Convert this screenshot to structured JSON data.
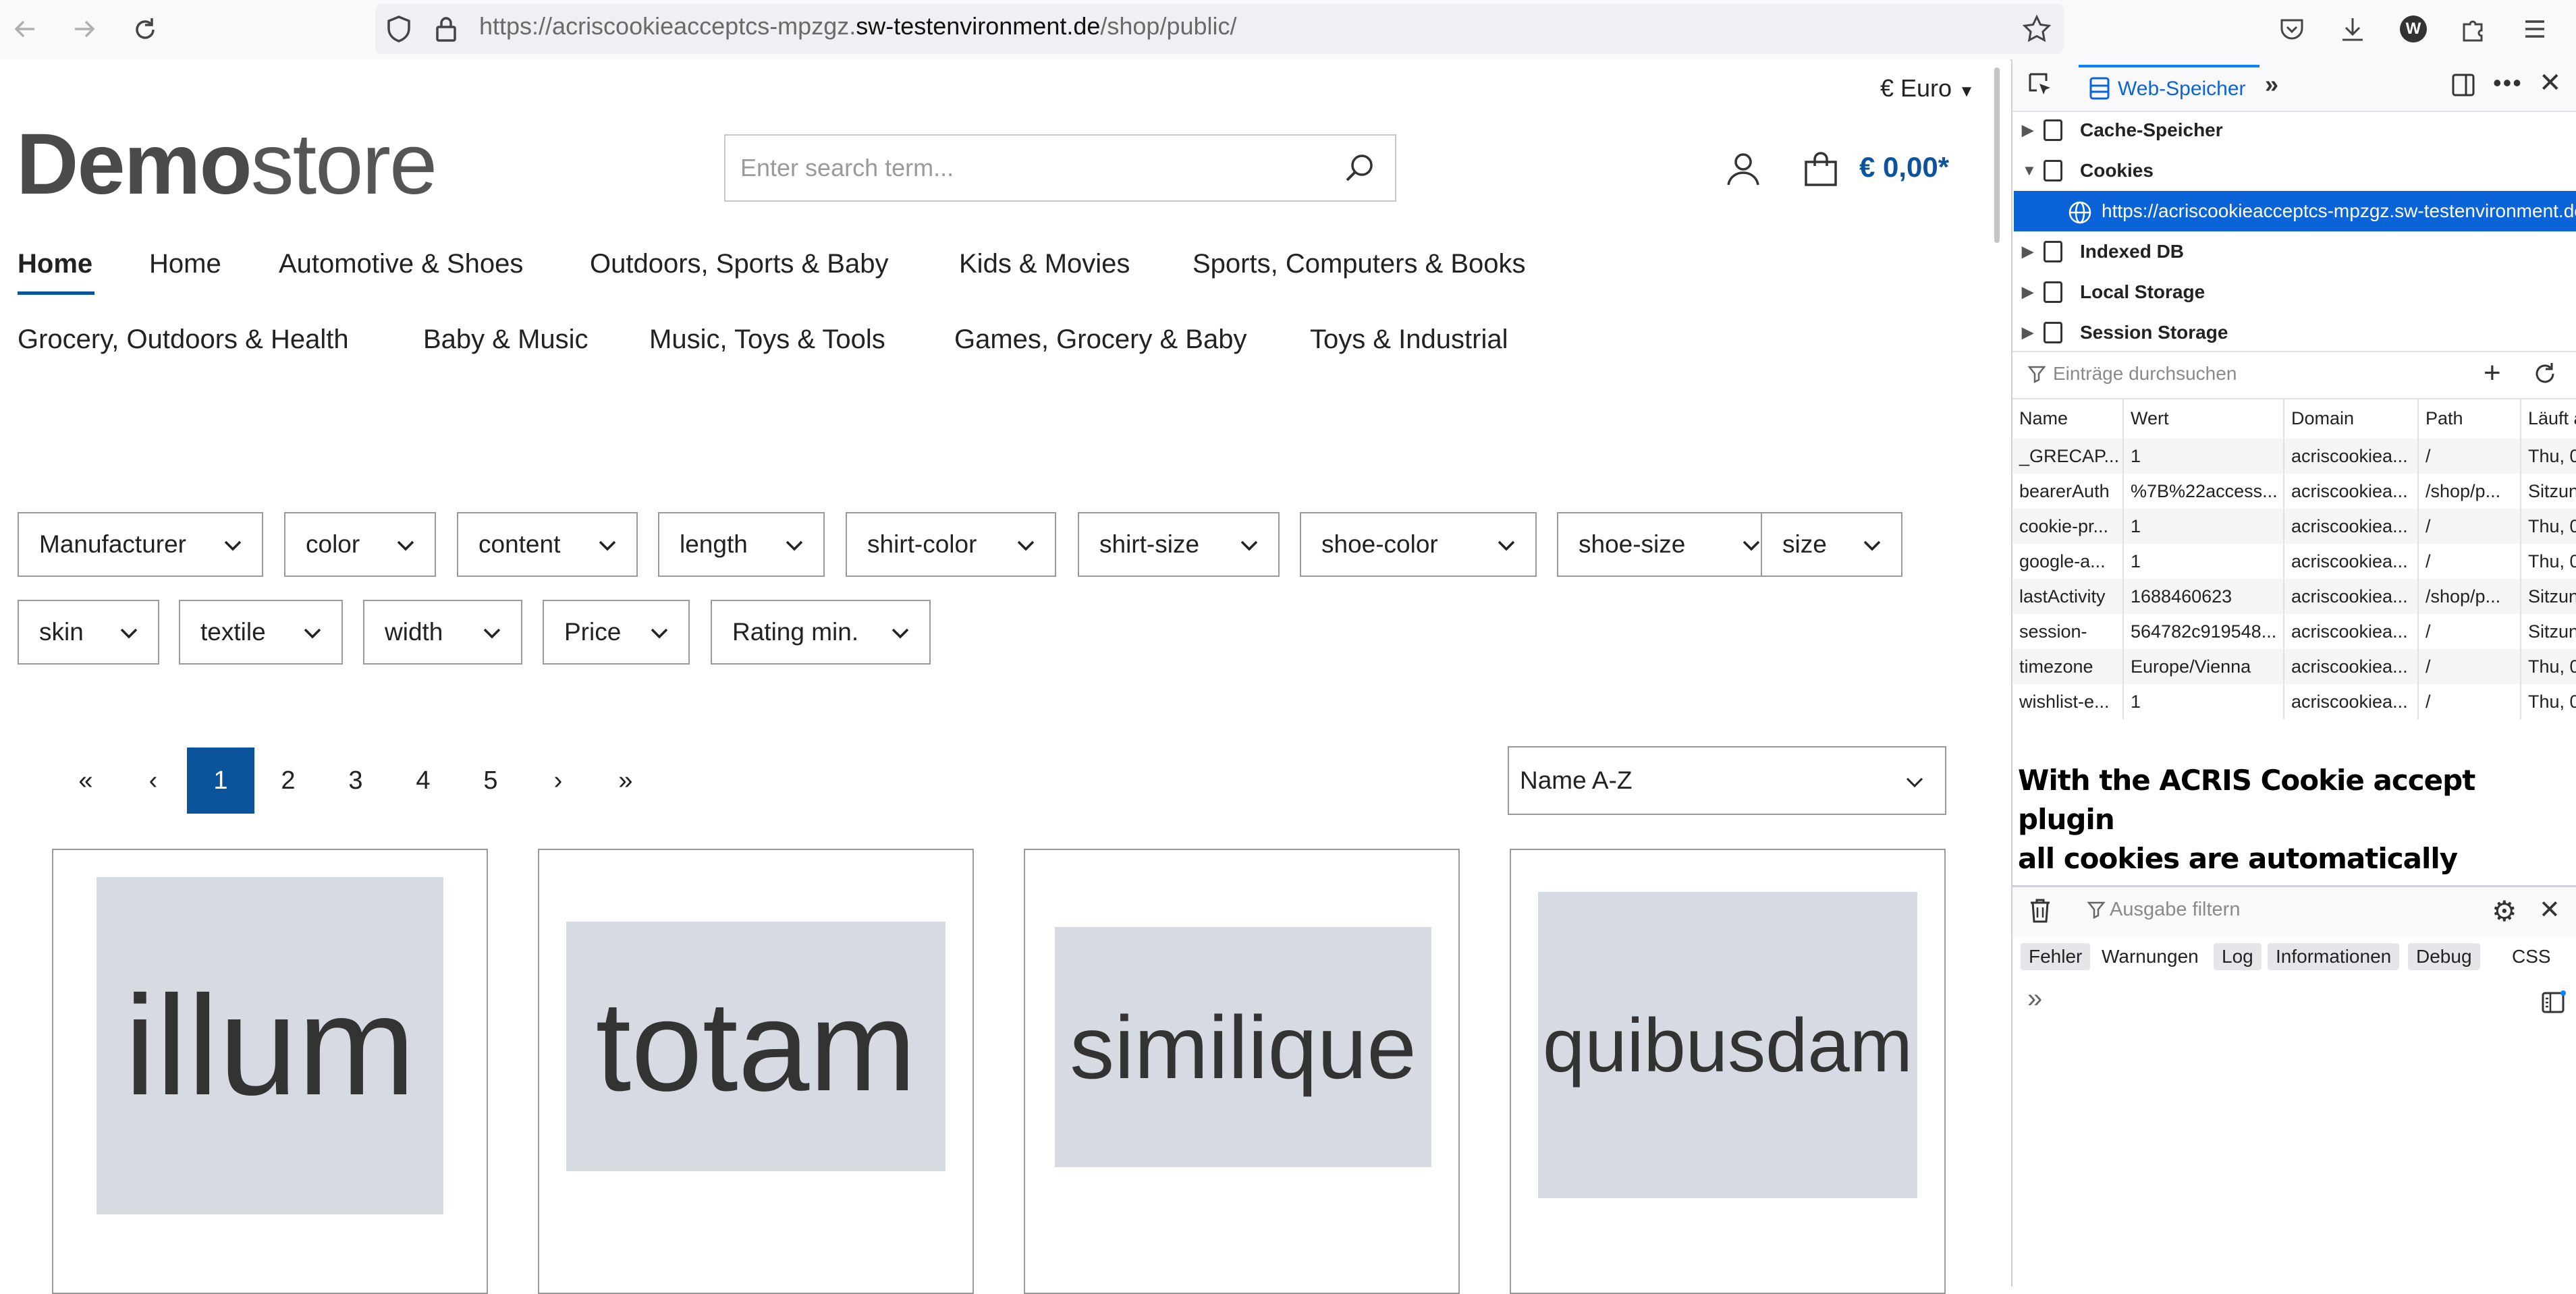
{
  "browser": {
    "url_prefix": "https://acriscookieacceptcs-mpzgz.",
    "url_domain": "sw-testenvironment.de",
    "url_path": "/shop/public/",
    "profile_initial": "W"
  },
  "shop": {
    "currency": "€ Euro",
    "logo_bold": "Demo",
    "logo_light": "store",
    "search_placeholder": "Enter search term...",
    "cart_total": "€ 0,00*",
    "nav": [
      "Home",
      "Home",
      "Automotive & Shoes",
      "Outdoors, Sports & Baby",
      "Kids & Movies",
      "Sports, Computers & Books",
      "Grocery, Outdoors & Health",
      "Baby & Music",
      "Music, Toys & Tools",
      "Games, Grocery & Baby",
      "Toys & Industrial"
    ],
    "filters": [
      "Manufacturer",
      "color",
      "content",
      "length",
      "shirt-color",
      "shirt-size",
      "shoe-color",
      "shoe-size",
      "size",
      "skin",
      "textile",
      "width",
      "Price",
      "Rating min."
    ],
    "pagination": {
      "first": "«",
      "prev": "‹",
      "pages": [
        "1",
        "2",
        "3",
        "4",
        "5"
      ],
      "active": "1",
      "next": "›",
      "last": "»"
    },
    "sort": "Name A-Z",
    "products": [
      "illum",
      "totam",
      "similique",
      "quibusdam"
    ]
  },
  "devtools": {
    "tab_label": "Web-Speicher",
    "tree": {
      "cache": "Cache-Speicher",
      "cookies": "Cookies",
      "cookie_url": "https://acriscookieacceptcs-mpzgz.sw-testenvironment.de",
      "indexed_db": "Indexed DB",
      "local_storage": "Local Storage",
      "session_storage": "Session Storage"
    },
    "filter_placeholder": "Einträge durchsuchen",
    "columns": [
      "Name",
      "Wert",
      "Domain",
      "Path",
      "Läuft a"
    ],
    "rows": [
      [
        "_GRECAP...",
        "1",
        "acriscookiea...",
        "/",
        "Thu, 0"
      ],
      [
        "bearerAuth",
        "%7B%22access...",
        "acriscookiea...",
        "/shop/p...",
        "Sitzun"
      ],
      [
        "cookie-pr...",
        "1",
        "acriscookiea...",
        "/",
        "Thu, 0"
      ],
      [
        "google-a...",
        "1",
        "acriscookiea...",
        "/",
        "Thu, 0"
      ],
      [
        "lastActivity",
        "1688460623",
        "acriscookiea...",
        "/shop/p...",
        "Sitzun"
      ],
      [
        "session-",
        "564782c919548...",
        "acriscookiea...",
        "/",
        "Sitzun"
      ],
      [
        "timezone",
        "Europe/Vienna",
        "acriscookiea...",
        "/",
        "Thu, 0"
      ],
      [
        "wishlist-e...",
        "1",
        "acriscookiea...",
        "/",
        "Thu, 0"
      ]
    ],
    "note_line1": "With the ACRIS Cookie accept plugin",
    "note_line2": "all cookies are automatically accepted",
    "console_placeholder": "Ausgabe filtern",
    "levels": [
      "Fehler",
      "Warnungen",
      "Log",
      "Informationen",
      "Debug",
      "CSS"
    ],
    "prompt": "»"
  },
  "colors": {
    "accent": "#0b539b",
    "devtools_selected": "#0a64d8"
  }
}
